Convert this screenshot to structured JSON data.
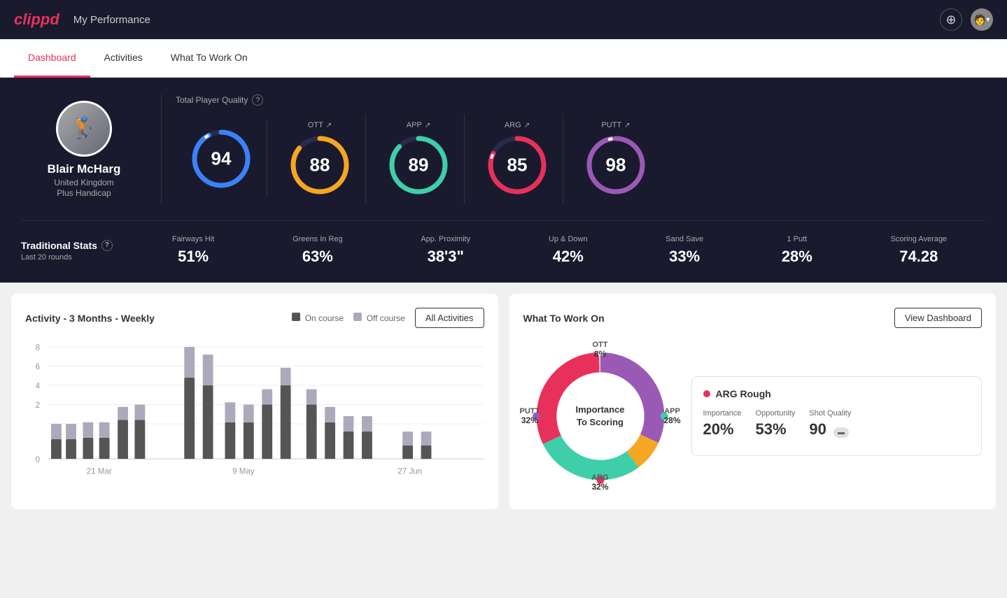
{
  "header": {
    "logo": "clippd",
    "title": "My Performance",
    "add_icon": "+",
    "chevron": "▾"
  },
  "tabs": [
    {
      "id": "dashboard",
      "label": "Dashboard",
      "active": true
    },
    {
      "id": "activities",
      "label": "Activities",
      "active": false
    },
    {
      "id": "what-to-work-on",
      "label": "What To Work On",
      "active": false
    }
  ],
  "player": {
    "name": "Blair McHarg",
    "country": "United Kingdom",
    "handicap": "Plus Handicap"
  },
  "quality": {
    "label": "Total Player Quality",
    "main_score": "94",
    "scores": [
      {
        "label": "OTT",
        "value": "88",
        "color": "#f5a623"
      },
      {
        "label": "APP",
        "value": "89",
        "color": "#3ecfaa"
      },
      {
        "label": "ARG",
        "value": "85",
        "color": "#e8315a"
      },
      {
        "label": "PUTT",
        "value": "98",
        "color": "#9b59b6"
      }
    ]
  },
  "trad_stats": {
    "label": "Traditional Stats",
    "sublabel": "Last 20 rounds",
    "items": [
      {
        "name": "Fairways Hit",
        "value": "51%"
      },
      {
        "name": "Greens In Reg",
        "value": "63%"
      },
      {
        "name": "App. Proximity",
        "value": "38'3\""
      },
      {
        "name": "Up & Down",
        "value": "42%"
      },
      {
        "name": "Sand Save",
        "value": "33%"
      },
      {
        "name": "1 Putt",
        "value": "28%"
      },
      {
        "name": "Scoring Average",
        "value": "74.28"
      }
    ]
  },
  "activity_chart": {
    "title": "Activity - 3 Months - Weekly",
    "legend": {
      "on_course": "On course",
      "off_course": "Off course"
    },
    "all_activities_btn": "All Activities",
    "x_labels": [
      "21 Mar",
      "9 May",
      "27 Jun"
    ],
    "y_labels": [
      "8",
      "6",
      "4",
      "2",
      "0"
    ],
    "colors": {
      "on_course": "#555",
      "off_course": "#aaa"
    }
  },
  "what_to_work_on": {
    "title": "What To Work On",
    "view_dashboard_btn": "View Dashboard",
    "donut": {
      "center_line1": "Importance",
      "center_line2": "To Scoring",
      "segments": [
        {
          "label": "OTT",
          "value": "8%",
          "color": "#f5a623"
        },
        {
          "label": "APP",
          "value": "28%",
          "color": "#3ecfaa"
        },
        {
          "label": "ARG",
          "value": "32%",
          "color": "#e8315a"
        },
        {
          "label": "PUTT",
          "value": "32%",
          "color": "#9b59b6"
        }
      ]
    },
    "info_card": {
      "title": "ARG Rough",
      "metrics": [
        {
          "name": "Importance",
          "value": "20%"
        },
        {
          "name": "Opportunity",
          "value": "53%"
        },
        {
          "name": "Shot Quality",
          "value": "90",
          "badge": ""
        }
      ]
    }
  }
}
